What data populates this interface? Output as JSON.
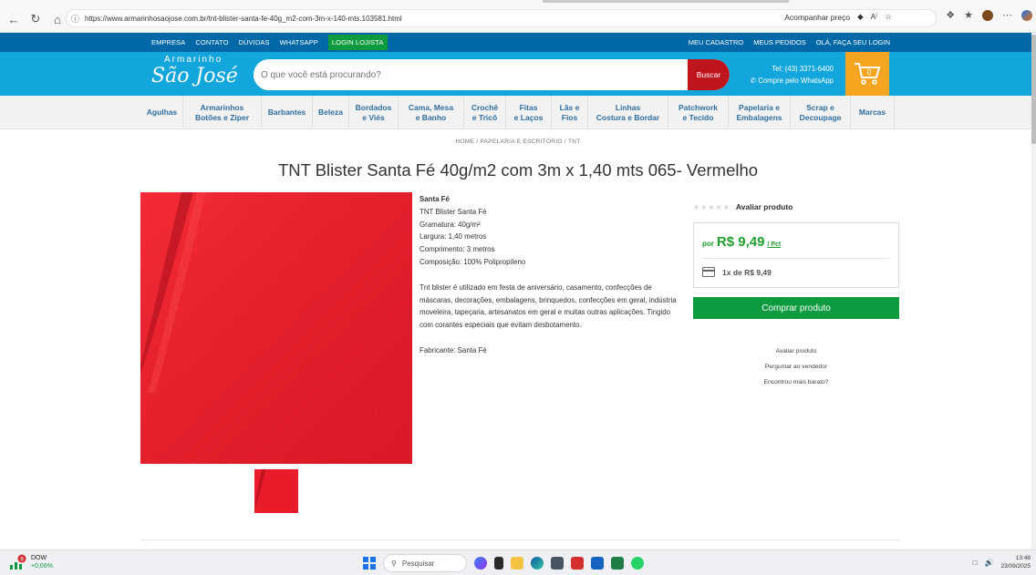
{
  "browser": {
    "url": "https://www.armarinhosaojose.com.br/tnt-blister-santa-fe-40g_m2-com-3m-x-140-mts.103581.html",
    "track_price": "Acompanhar preço"
  },
  "top_nav": {
    "links": [
      "EMPRESA",
      "CONTATO",
      "DÚVIDAS",
      "WHATSAPP"
    ],
    "login": "LOGIN LOJISTA",
    "right_links": [
      "MEU CADASTRO",
      "MEUS PEDIDOS",
      "OLÁ, FAÇA SEU LOGIN"
    ]
  },
  "header": {
    "logo_top": "Armarinho",
    "logo_main": "São José",
    "search_placeholder": "O que você está procurando?",
    "search_button": "Buscar",
    "phone": "Tel: (43) 3371-6400",
    "whatsapp": "Compre pelo WhatsApp",
    "cart_count": "0"
  },
  "categories": [
    {
      "l1": "Agulhas",
      "l2": ""
    },
    {
      "l1": "Armarinhos",
      "l2": "Botões e Ziper"
    },
    {
      "l1": "Barbantes",
      "l2": ""
    },
    {
      "l1": "Beleza",
      "l2": ""
    },
    {
      "l1": "Bordados",
      "l2": "e Viés"
    },
    {
      "l1": "Cama, Mesa",
      "l2": "e Banho"
    },
    {
      "l1": "Crochê",
      "l2": "e Tricô"
    },
    {
      "l1": "Fitas",
      "l2": "e Laços"
    },
    {
      "l1": "Lãs e",
      "l2": "Fios"
    },
    {
      "l1": "Linhas",
      "l2": "Costura e Bordar"
    },
    {
      "l1": "Patchwork",
      "l2": "e Tecido"
    },
    {
      "l1": "Papelaria e",
      "l2": "Embalagens"
    },
    {
      "l1": "Scrap e",
      "l2": "Decoupage"
    },
    {
      "l1": "Marcas",
      "l2": ""
    }
  ],
  "breadcrumb": "HOME   /   PAPELARIA E ESCRITÓRIO   /   TNT",
  "product": {
    "title": "TNT Blister Santa Fé 40g/m2 com 3m x 1,40 mts 065- Vermelho",
    "brand": "Santa Fé",
    "specs": [
      "TNT Blister Santa Fé",
      "Gramatura: 40g/m²",
      "Largura: 1,40 metros",
      "Comprimento: 3 metros",
      "Composição: 100% Polipropileno"
    ],
    "description": "Tnt blister é utilizado em festa de aniversário, casamento, confecções de máscaras, decorações, embalagens, brinquedos, confecções em geral, indústria moveleira, tapeçaria, artesanatos em geral e muitas outras aplicações. Tingido com corantes especiais que evitam desbotamento.",
    "manufacturer": "Fabricante: Santa Fé",
    "color": "#e81c2a"
  },
  "purchase": {
    "rating_label": "Avaliar produto",
    "price_prefix": "por",
    "price": "R$ 9,49",
    "unit": "/ Pct",
    "installment": "1x de R$ 9,49",
    "buy_button": "Comprar produto",
    "links": [
      "Avaliar produto",
      "Perguntar ao vendedor",
      "Encontrou mais barato?"
    ],
    "accent": "#0e9b3f",
    "price_color": "#1f9d2e"
  },
  "taskbar": {
    "ticker_name": "DOW",
    "ticker_change": "+0,06%",
    "ticker_badge": "9",
    "search": "Pesquisar",
    "time": "13:48",
    "date": "23/09/2025"
  }
}
